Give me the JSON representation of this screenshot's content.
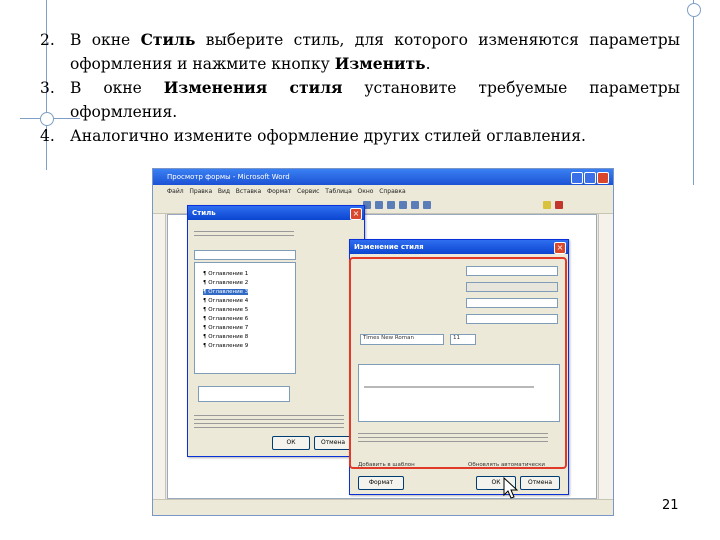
{
  "instructions": [
    {
      "num": "2.",
      "before": "В окне ",
      "bold": "Стиль",
      "middle": " выберите стиль, для которого изменяются параметры оформления и нажмите кнопку ",
      "bold2": "Изменить",
      "after": "."
    },
    {
      "num": "3.",
      "before": "В окне ",
      "bold": "Изменения стиля",
      "middle": " установите требуемые параметры оформления.",
      "bold2": "",
      "after": ""
    },
    {
      "num": "4.",
      "before": "Аналогично измените оформление других стилей оглавления.",
      "bold": "",
      "middle": "",
      "bold2": "",
      "after": ""
    }
  ],
  "screenshot": {
    "word_window_title": "Просмотр формы - Microsoft Word",
    "menu_items": [
      "Файл",
      "Правка",
      "Вид",
      "Вставка",
      "Формат",
      "Сервис",
      "Таблица",
      "Окно",
      "Справка"
    ],
    "style_dialog": {
      "title": "Стиль",
      "list_items": [
        "¶ Оглавление 1",
        "¶ Оглавление 2",
        "¶ Оглавление 3",
        "¶ Оглавление 4",
        "¶ Оглавление 5",
        "¶ Оглавление 6",
        "¶ Оглавление 7",
        "¶ Оглавление 8",
        "¶ Оглавление 9"
      ],
      "ok_label": "ОК",
      "cancel_label": "Отмена"
    },
    "modify_dialog": {
      "title": "Изменение стиля",
      "font_name": "Times New Roman",
      "font_size": "11",
      "add_to_template_label": "Добавить в шаблон",
      "auto_update_label": "Обновлять автоматически",
      "format_label": "Формат",
      "ok_label": "ОК",
      "cancel_label": "Отмена"
    }
  },
  "page_number": "21",
  "colors": {
    "accent": "#7f9fc6",
    "title_bar": "#0a45d0",
    "highlight_frame": "#e23a2a"
  }
}
